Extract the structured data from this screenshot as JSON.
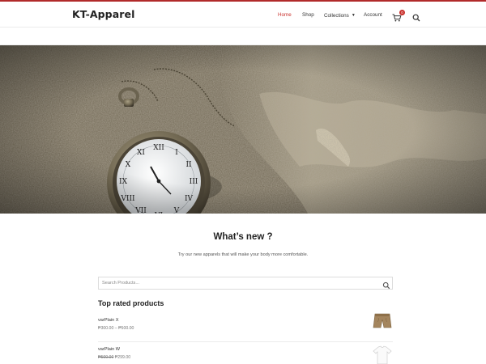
{
  "brand": {
    "name": "KT-Apparel"
  },
  "nav": {
    "items": [
      {
        "label": "Home",
        "active": true
      },
      {
        "label": "Shop",
        "active": false
      },
      {
        "label": "Collections",
        "active": false,
        "has_dropdown": true
      },
      {
        "label": "Account",
        "active": false
      }
    ],
    "cart_count": "0",
    "icons": {
      "cart": "cart-icon",
      "search": "search-icon",
      "dropdown": "chevron-down-icon"
    }
  },
  "hero": {
    "image": "pocket watch on sand with world map"
  },
  "section": {
    "title": "What’s new ?",
    "subtitle": "Try our new apparels that will make your body more comfortable."
  },
  "search": {
    "placeholder": "Search Products...",
    "icon": "search-icon"
  },
  "top_rated": {
    "heading": "Top rated products",
    "products": [
      {
        "name": "varPlain X",
        "price_range": "₱300.00 – ₱500.00",
        "thumb": "shorts"
      },
      {
        "name": "varPlain W",
        "old_price": "₱500.00",
        "price": "₱299.00",
        "thumb": "t-shirt"
      }
    ]
  },
  "colors": {
    "accent": "#c9302c",
    "text": "#222222",
    "muted": "#777777"
  }
}
